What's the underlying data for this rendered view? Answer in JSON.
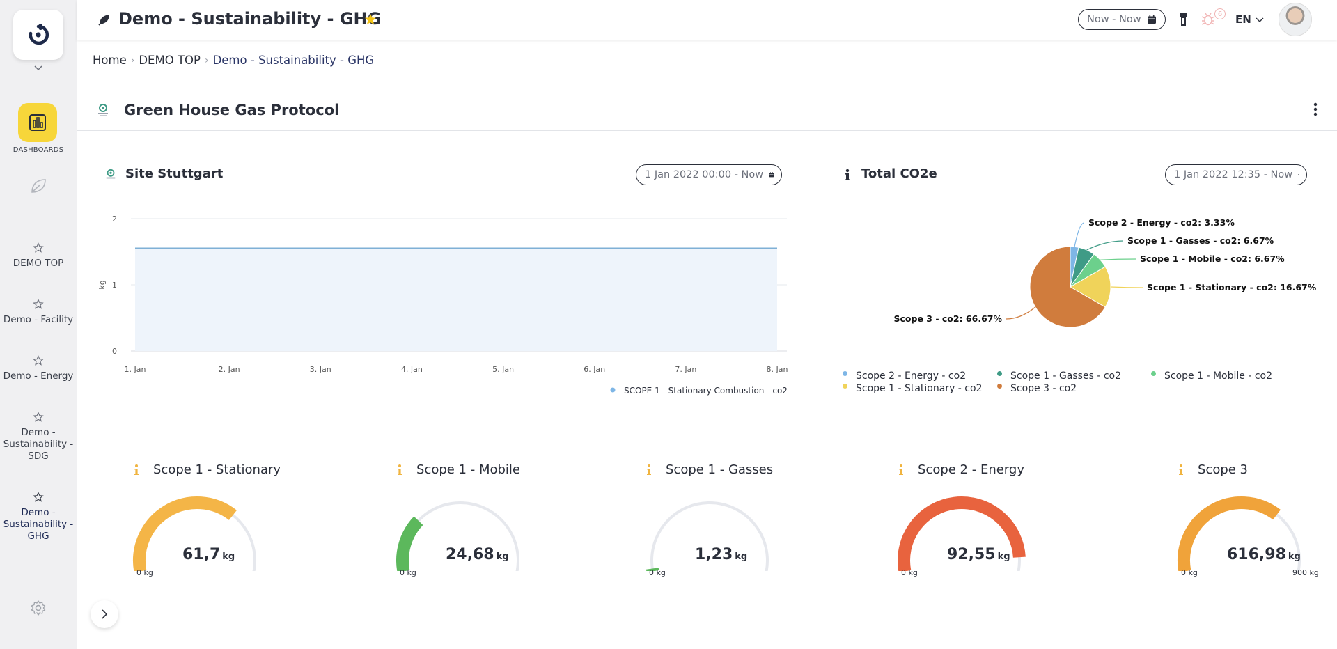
{
  "header": {
    "title": "Demo - Sustainability - GHG",
    "date_range": "Now - Now",
    "language": "EN",
    "notification_count": "6"
  },
  "sidebar": {
    "dashboards_label": "DASHBOARDS",
    "items": [
      {
        "label": "DEMO TOP"
      },
      {
        "label": "Demo - Facility"
      },
      {
        "label": "Demo - Energy"
      },
      {
        "label": "Demo - Sustainability - SDG"
      },
      {
        "label": "Demo - Sustainability - GHG"
      }
    ]
  },
  "breadcrumb": [
    "Home",
    "DEMO TOP",
    "Demo - Sustainability - GHG"
  ],
  "section": {
    "title": "Green House Gas Protocol"
  },
  "line_widget": {
    "title": "Site Stuttgart",
    "date_range": "1 Jan 2022 00:00 - Now"
  },
  "pie_widget": {
    "title": "Total CO2e",
    "date_range": "1 Jan 2022 12:35 - Now"
  },
  "gauges": [
    {
      "title": "Scope 1 - Stationary",
      "value": "61,7",
      "unit": "kg",
      "min_label": "0 kg",
      "max_label": "",
      "fraction": 0.69,
      "color": "#f4b547"
    },
    {
      "title": "Scope 1 - Mobile",
      "value": "24,68",
      "unit": "kg",
      "min_label": "0 kg",
      "max_label": "",
      "fraction": 0.27,
      "color": "#5cb85c"
    },
    {
      "title": "Scope 1 - Gasses",
      "value": "1,23",
      "unit": "kg",
      "min_label": "0 kg",
      "max_label": "",
      "fraction": 0.014,
      "color": "#5cb85c"
    },
    {
      "title": "Scope 2 - Energy",
      "value": "92,55",
      "unit": "kg",
      "min_label": "0 kg",
      "max_label": "",
      "fraction": 0.93,
      "color": "#e8633e"
    },
    {
      "title": "Scope 3",
      "value": "616,98",
      "unit": "kg",
      "min_label": "0 kg",
      "max_label": "900 kg",
      "fraction": 0.686,
      "color": "#f0a33a"
    }
  ],
  "colors": {
    "accent": "#f7d63a",
    "gauge_track": "#e6e8ed",
    "line": "#7fb0d6",
    "area": "#eef4fb"
  },
  "chart_data": [
    {
      "type": "area",
      "x": [
        "1. Jan",
        "2. Jan",
        "3. Jan",
        "4. Jan",
        "5. Jan",
        "6. Jan",
        "7. Jan",
        "8. Jan"
      ],
      "series": [
        {
          "name": "SCOPE 1 - Stationary Combustion - co2",
          "values": [
            1.55,
            1.55,
            1.55,
            1.55,
            1.55,
            1.55,
            1.55,
            1.55
          ]
        }
      ],
      "ylabel": "kg",
      "ylim": [
        0,
        2
      ],
      "yticks": [
        "0",
        "1",
        "2"
      ],
      "grid": true,
      "legend": "bottom-right"
    },
    {
      "type": "pie",
      "slices": [
        {
          "label": "Scope 2 - Energy - co2",
          "value": 3.33,
          "display": "Scope 2 - Energy - co2: 3.33%",
          "color": "#7eb6e6"
        },
        {
          "label": "Scope 1 - Gasses - co2",
          "value": 6.67,
          "display": "Scope 1 - Gasses - co2: 6.67%",
          "color": "#3f9b86"
        },
        {
          "label": "Scope 1 - Mobile - co2",
          "value": 6.67,
          "display": "Scope 1 - Mobile - co2: 6.67%",
          "color": "#6cd08c"
        },
        {
          "label": "Scope 1 - Stationary - co2",
          "value": 16.67,
          "display": "Scope 1 - Stationary - co2: 16.67%",
          "color": "#f0d35a"
        },
        {
          "label": "Scope 3 - co2",
          "value": 66.67,
          "display": "Scope 3 - co2: 66.67%",
          "color": "#d07c3d"
        }
      ],
      "legend": "bottom"
    }
  ]
}
